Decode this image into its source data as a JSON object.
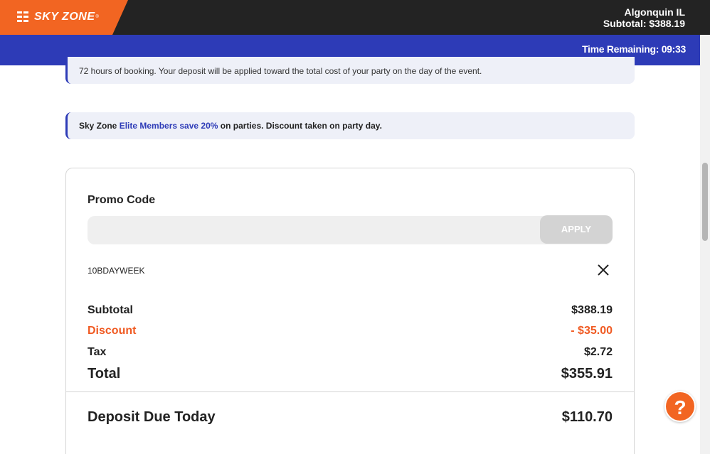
{
  "header": {
    "brand": "SKY ZONE",
    "brand_tm": "®",
    "location": "Algonquin IL",
    "subtotal": "Subtotal: $388.19",
    "time_remaining": "Time Remaining: 09:33"
  },
  "notices": {
    "deposit_text": "72 hours of booking. Your deposit will be applied toward the total cost of your party on the day of the event.",
    "elite_prefix": "Sky Zone ",
    "elite_highlight": "Elite Members save 20%",
    "elite_suffix": " on parties. Discount taken on party day."
  },
  "promo": {
    "label": "Promo Code",
    "placeholder": "",
    "apply_label": "APPLY",
    "applied_code": "10BDAYWEEK"
  },
  "summary": {
    "subtotal_label": "Subtotal",
    "subtotal_value": "$388.19",
    "discount_label": "Discount",
    "discount_value": "- $35.00",
    "tax_label": "Tax",
    "tax_value": "$2.72",
    "total_label": "Total",
    "total_value": "$355.91",
    "deposit_label": "Deposit Due Today",
    "deposit_value": "$110.70"
  },
  "help": {
    "label": "?"
  },
  "colors": {
    "brand_orange": "#f26522",
    "brand_blue": "#2d3bb7",
    "discount": "#f05a22"
  }
}
